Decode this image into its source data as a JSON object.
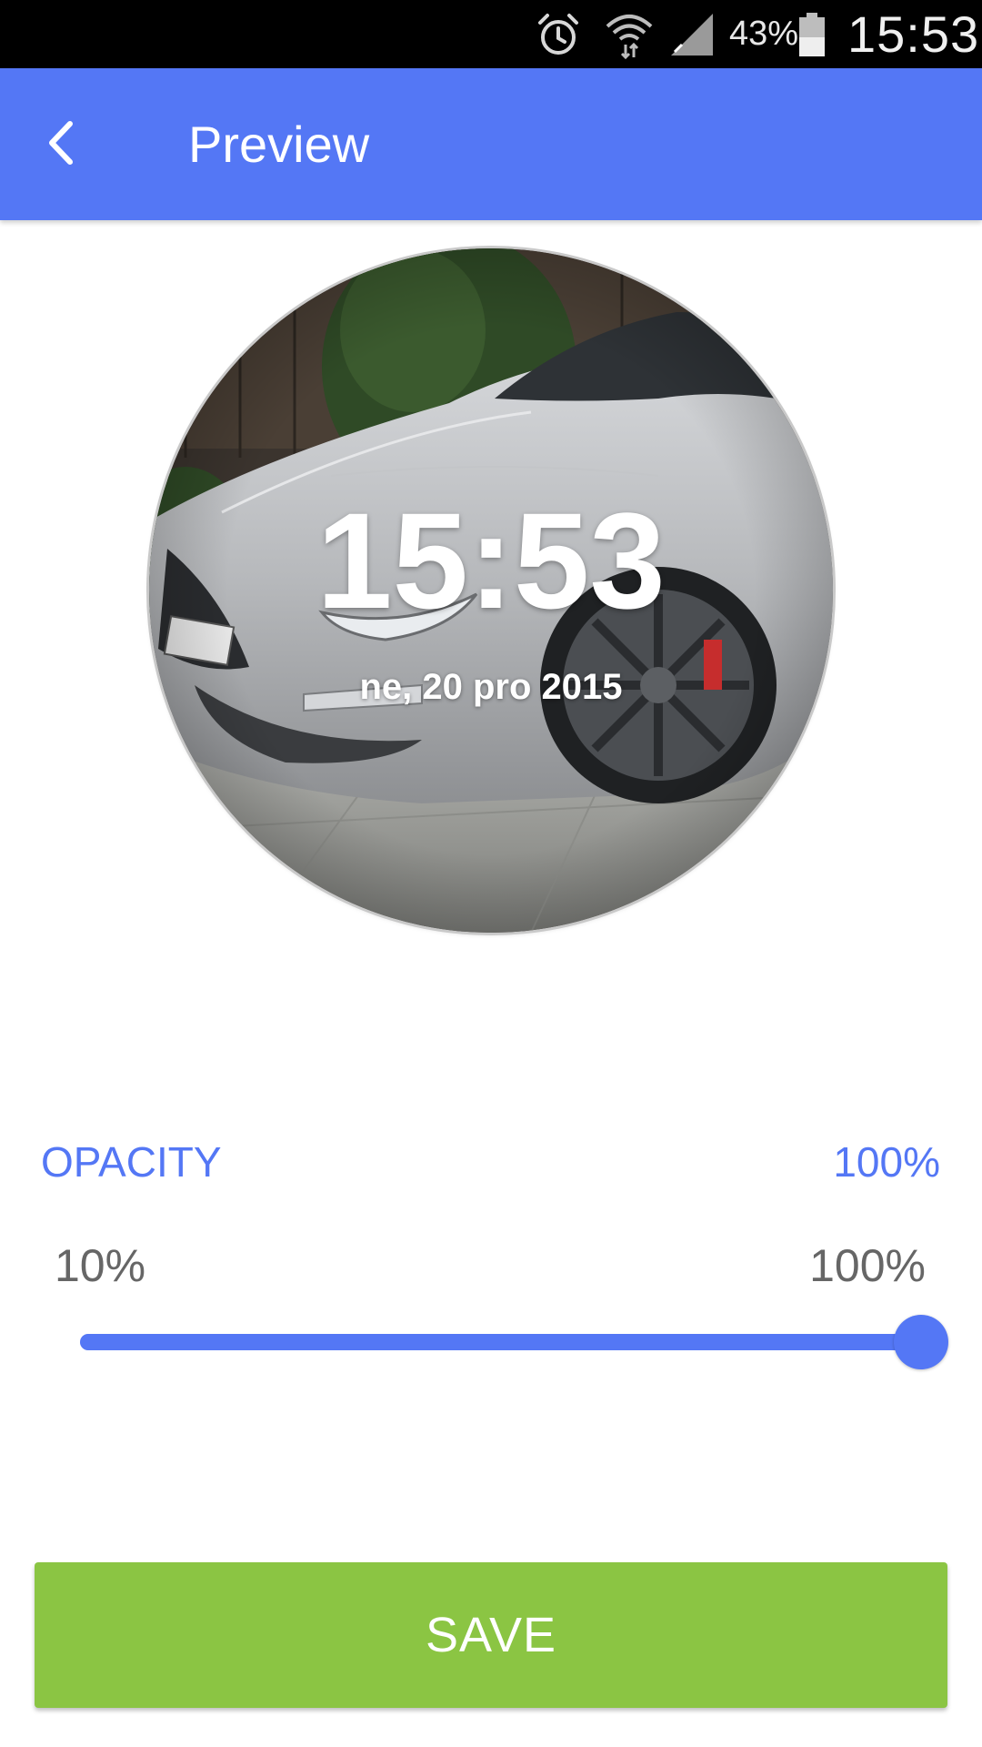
{
  "status_bar": {
    "battery_percent": "43%",
    "time": "15:53",
    "icons": [
      "alarm-icon",
      "wifi-icon",
      "signal-icon",
      "battery-icon"
    ]
  },
  "app_bar": {
    "title": "Preview",
    "back_icon": "chevron-left-icon",
    "color": "#5477f5"
  },
  "preview": {
    "time": "15:53",
    "date": "ne, 20 pro 2015",
    "background": "silver car photo"
  },
  "opacity": {
    "label": "OPACITY",
    "value": "100%",
    "min_label": "10%",
    "max_label": "100%",
    "level_fraction": 1.0
  },
  "save_button": {
    "label": "SAVE",
    "color": "#8bc543"
  }
}
